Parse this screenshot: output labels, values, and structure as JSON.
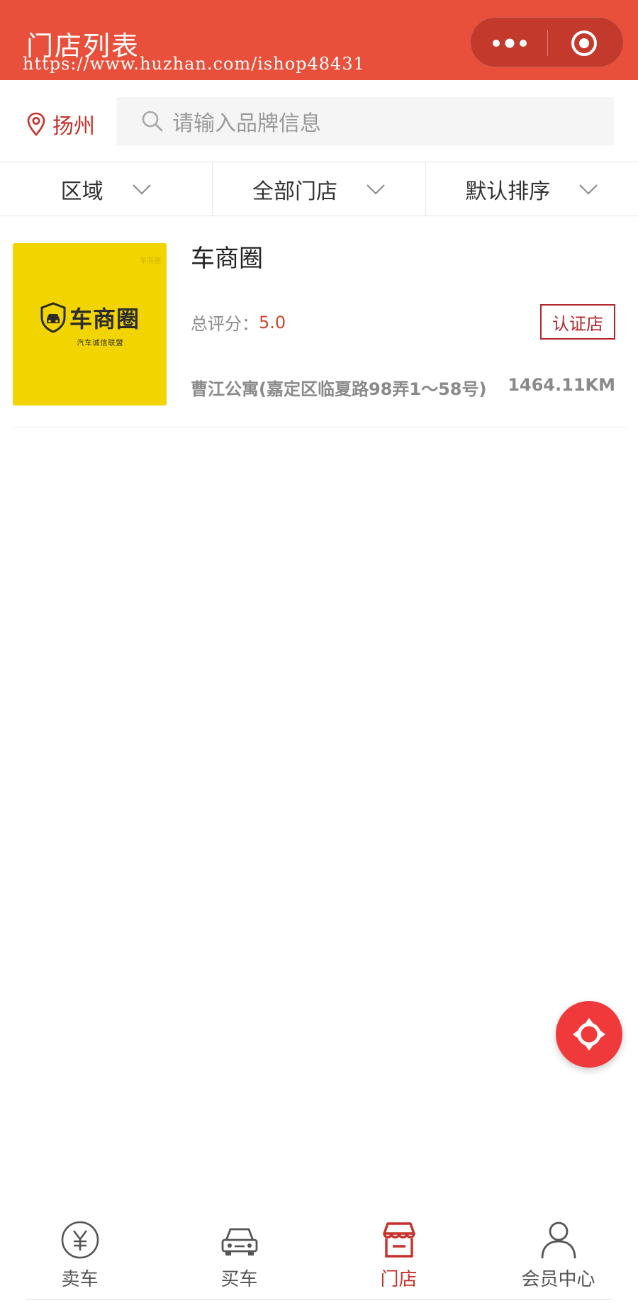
{
  "header": {
    "title": "门店列表",
    "watermark_url": "https://www.huzhan.com/ishop48431",
    "more_icon": "more-dots-icon",
    "close_icon": "close-target-icon"
  },
  "search": {
    "location": "扬州",
    "placeholder": "请输入品牌信息"
  },
  "filters": [
    {
      "label": "区域"
    },
    {
      "label": "全部门店"
    },
    {
      "label": "默认排序"
    }
  ],
  "stores": [
    {
      "name": "车商圈",
      "logo_text": "车商圈",
      "logo_subtitle": "汽车诚信联盟",
      "logo_corner": "车商圈",
      "rating_label": "总评分：",
      "rating_value": "5.0",
      "badge": "认证店",
      "address": "曹江公寓(嘉定区临夏路98弄1～58号)",
      "distance": "1464.11KM"
    }
  ],
  "tabs": [
    {
      "label": "卖车",
      "icon": "yen-coin-icon",
      "active": false
    },
    {
      "label": "买车",
      "icon": "car-icon",
      "active": false
    },
    {
      "label": "门店",
      "icon": "store-icon",
      "active": true
    },
    {
      "label": "会员中心",
      "icon": "user-icon",
      "active": false
    }
  ],
  "colors": {
    "header_bg": "#e9503b",
    "accent_red": "#c8312b",
    "fab_bg": "#f0393a",
    "logo_bg": "#f2d500"
  }
}
